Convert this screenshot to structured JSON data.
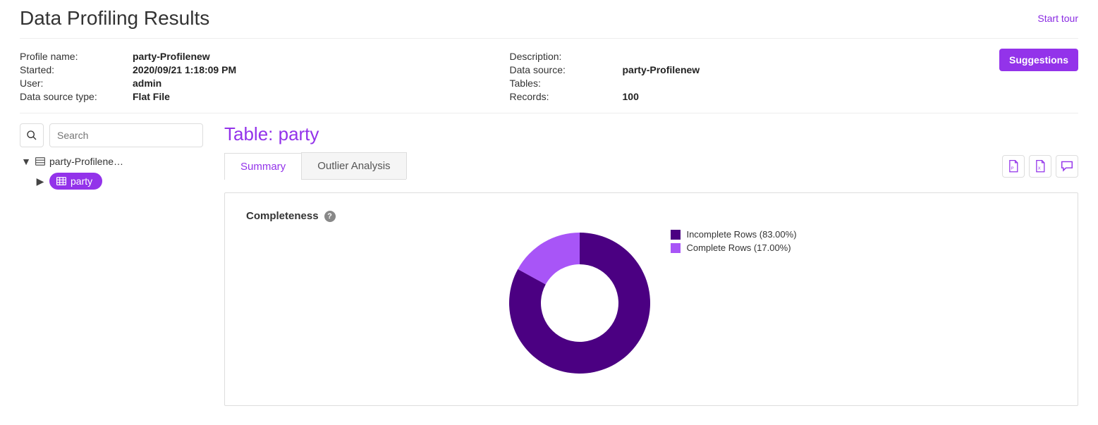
{
  "page_title": "Data Profiling Results",
  "start_tour": "Start tour",
  "suggestions_btn": "Suggestions",
  "meta_left": {
    "profile_name_label": "Profile name:",
    "profile_name_value": "party-Profilenew",
    "started_label": "Started:",
    "started_value": "2020/09/21 1:18:09 PM",
    "user_label": "User:",
    "user_value": "admin",
    "dstype_label": "Data source type:",
    "dstype_value": "Flat File"
  },
  "meta_right": {
    "description_label": "Description:",
    "description_value": "",
    "datasource_label": "Data source:",
    "datasource_value": "party-Profilenew",
    "tables_label": "Tables:",
    "tables_value": "",
    "records_label": "Records:",
    "records_value": "100"
  },
  "search": {
    "placeholder": "Search",
    "value": ""
  },
  "tree": {
    "root_label": "party-Profilene…",
    "child_label": "party"
  },
  "table_title": "Table: party",
  "tabs": {
    "summary": "Summary",
    "outlier": "Outlier Analysis"
  },
  "card": {
    "completeness_title": "Completeness"
  },
  "chart_data": {
    "type": "pie",
    "title": "Completeness",
    "series": [
      {
        "name": "Incomplete Rows",
        "value": 83.0,
        "color": "#4b0082",
        "legend": "Incomplete Rows (83.00%)"
      },
      {
        "name": "Complete Rows",
        "value": 17.0,
        "color": "#a855f7",
        "legend": "Complete Rows (17.00%)"
      }
    ],
    "hole": 0.55
  }
}
